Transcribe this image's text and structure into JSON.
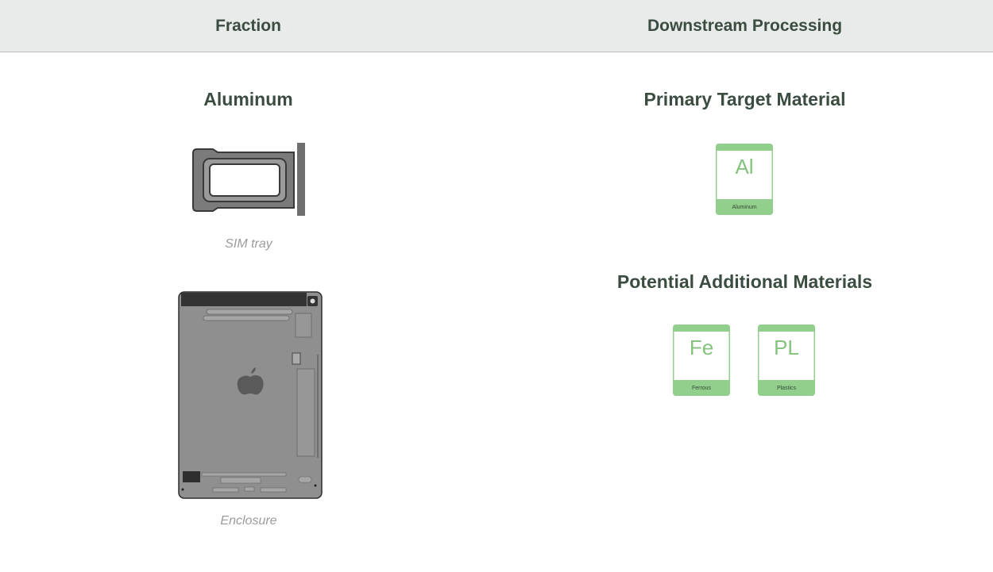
{
  "header": {
    "fraction": "Fraction",
    "downstream": "Downstream Processing"
  },
  "fraction": {
    "title": "Aluminum",
    "items": [
      {
        "caption": "SIM tray",
        "icon": "sim-tray-image"
      },
      {
        "caption": "Enclosure",
        "icon": "enclosure-image"
      }
    ]
  },
  "downstream": {
    "primary_title": "Primary Target Material",
    "primary": [
      {
        "symbol": "Al",
        "name": "Aluminum"
      }
    ],
    "additional_title": "Potential Additional Materials",
    "additional": [
      {
        "symbol": "Fe",
        "name": "Ferrous"
      },
      {
        "symbol": "PL",
        "name": "Plastics"
      }
    ]
  },
  "colors": {
    "header_bg": "#e9ebea",
    "title_text": "#3b4d40",
    "tile_green": "#93cf8c",
    "device_gray": "#8a8a8a"
  }
}
